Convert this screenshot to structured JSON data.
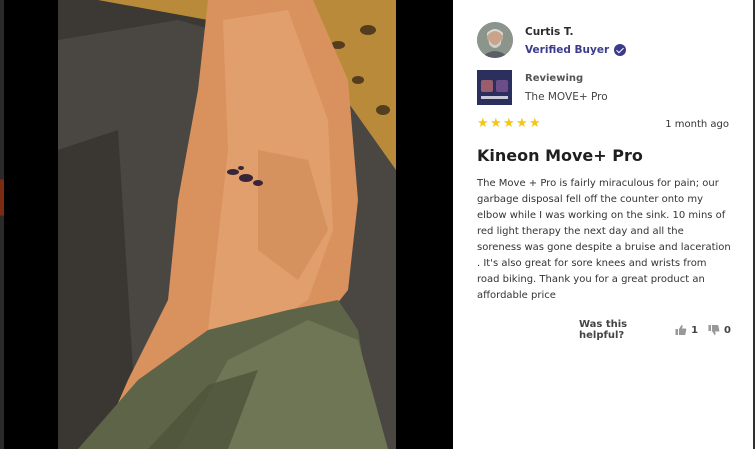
{
  "reviewer": {
    "name": "Curtis T.",
    "badge": "Verified Buyer",
    "avatar_icon": "user-avatar"
  },
  "product": {
    "label": "Reviewing",
    "name": "The MOVE+ Pro",
    "thumbnail_icon": "product-thumbnail"
  },
  "review": {
    "rating": 5,
    "date": "1 month ago",
    "title": "Kineon Move+ Pro",
    "text": "The Move + Pro is fairly miraculous for pain; our garbage disposal fell off the counter onto my elbow while I was working on the sink. 10 mins of red light therapy the next day and all the soreness was gone despite a bruise and laceration . It's also great for sore knees and wrists from road biking. Thank you for a great product an affordable price"
  },
  "helpful": {
    "label": "Was this helpful?",
    "up_count": "1",
    "down_count": "0"
  },
  "colors": {
    "accent": "#3b3a8c",
    "star": "#f5c518",
    "card_bg": "#ffffff",
    "backdrop": "#000000"
  }
}
